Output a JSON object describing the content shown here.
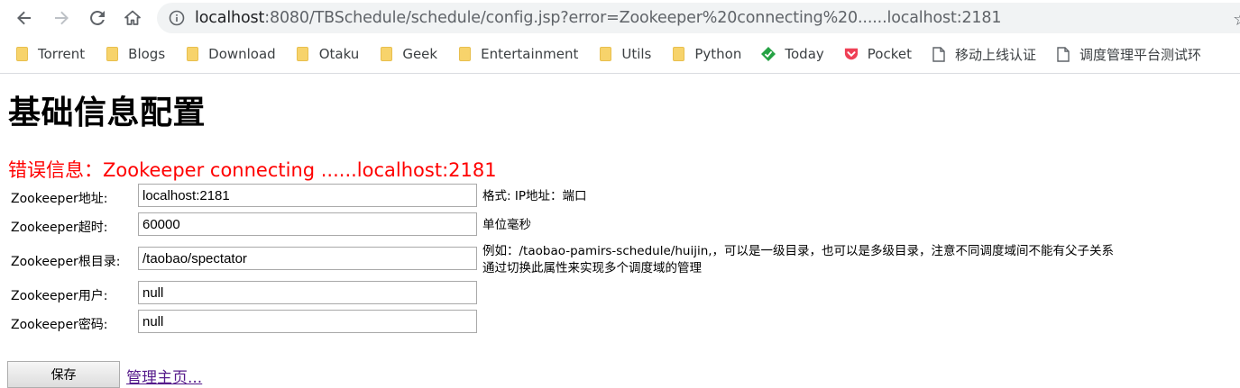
{
  "browser": {
    "url_host": "localhost",
    "url_path": ":8080/TBSchedule/schedule/config.jsp?error=Zookeeper%20connecting%20......localhost:2181",
    "bookmarks": [
      {
        "label": "Torrent",
        "icon": "folder-icon"
      },
      {
        "label": "Blogs",
        "icon": "folder-icon"
      },
      {
        "label": "Download",
        "icon": "folder-icon"
      },
      {
        "label": "Otaku",
        "icon": "folder-icon"
      },
      {
        "label": "Geek",
        "icon": "folder-icon"
      },
      {
        "label": "Entertainment",
        "icon": "folder-icon"
      },
      {
        "label": "Utils",
        "icon": "folder-icon"
      },
      {
        "label": "Python",
        "icon": "folder-icon"
      },
      {
        "label": "Today",
        "icon": "today-app-icon"
      },
      {
        "label": "Pocket",
        "icon": "pocket-icon"
      },
      {
        "label": "移动上线认证",
        "icon": "page-icon"
      },
      {
        "label": "调度管理平台测试环",
        "icon": "page-icon"
      }
    ]
  },
  "page": {
    "title": "基础信息配置",
    "error": "错误信息：Zookeeper connecting ......localhost:2181",
    "fields": {
      "address": {
        "label": "Zookeeper地址:",
        "value": "localhost:2181",
        "hint": "格式: IP地址：端口"
      },
      "timeout": {
        "label": "Zookeeper超时:",
        "value": "60000",
        "hint": "单位毫秒"
      },
      "root": {
        "label": "Zookeeper根目录:",
        "value": "/taobao/spectator",
        "hint_line1": "例如：/taobao-pamirs-schedule/huijin,，可以是一级目录，也可以是多级目录，注意不同调度域间不能有父子关系",
        "hint_line2": "通过切换此属性来实现多个调度域的管理"
      },
      "user": {
        "label": "Zookeeper用户:",
        "value": "null"
      },
      "password": {
        "label": "Zookeeper密码:",
        "value": "null"
      }
    },
    "save_label": "保存",
    "home_link": "管理主页..."
  },
  "colors": {
    "error": "#ff0000",
    "link_visited": "#551a8b",
    "omnibox_bg": "#f1f3f4"
  }
}
